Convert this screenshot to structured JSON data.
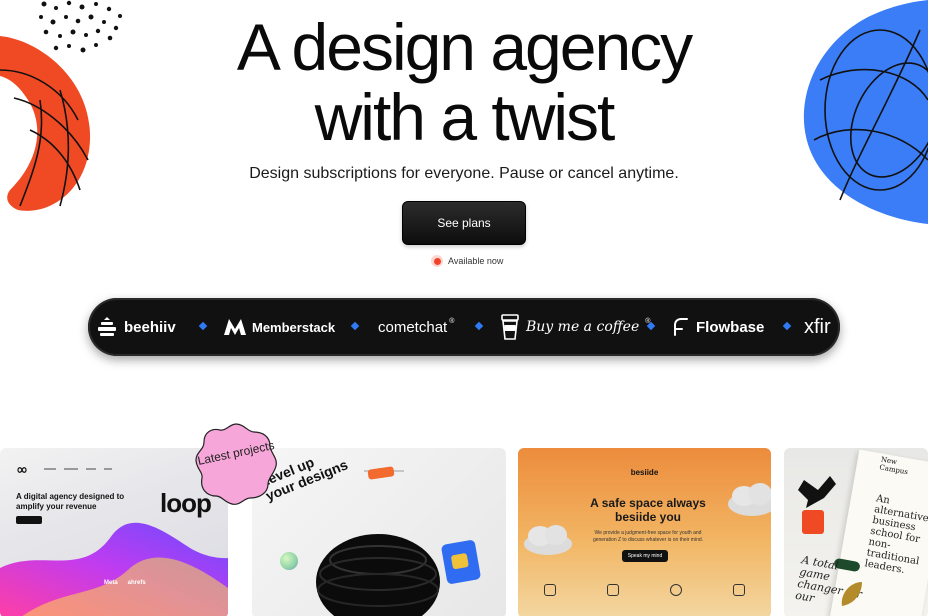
{
  "hero": {
    "title_line1": "A design agency",
    "title_line2": "with a twist",
    "subtitle": "Design subscriptions for everyone. Pause or cancel anytime.",
    "cta_label": "See plans",
    "status_text": "Available now"
  },
  "logos": [
    {
      "name": "beehiiv"
    },
    {
      "name": "Memberstack"
    },
    {
      "name": "cometchat"
    },
    {
      "name": "Buy me a coffee"
    },
    {
      "name": "Flowbase"
    },
    {
      "name": "xfir"
    }
  ],
  "badge": {
    "label": "Latest projects"
  },
  "projects": {
    "loop": {
      "headline": "A digital agency designed to amplify your revenue",
      "wordmark": "loop",
      "footer_logos": [
        "Meta",
        "ahrefs"
      ]
    },
    "level": {
      "headline": "Level up your designs"
    },
    "besiide": {
      "brand": "besiide",
      "headline": "A safe space always besiide you",
      "body": "We provide a judgment-free space for youth and generation Z to discuss whatever is on their mind.",
      "button": "Speak my mind"
    },
    "campus": {
      "brand": "New Campus",
      "headline": "An alternative business school for non-traditional leaders.",
      "quote": "A total game changer for our"
    }
  },
  "colors": {
    "accent_red": "#f0422b",
    "blob_red": "#f04a24",
    "blob_blue": "#3a7df6",
    "diamond_blue": "#2f7bf6",
    "badge_pink": "#f6a6d9"
  }
}
